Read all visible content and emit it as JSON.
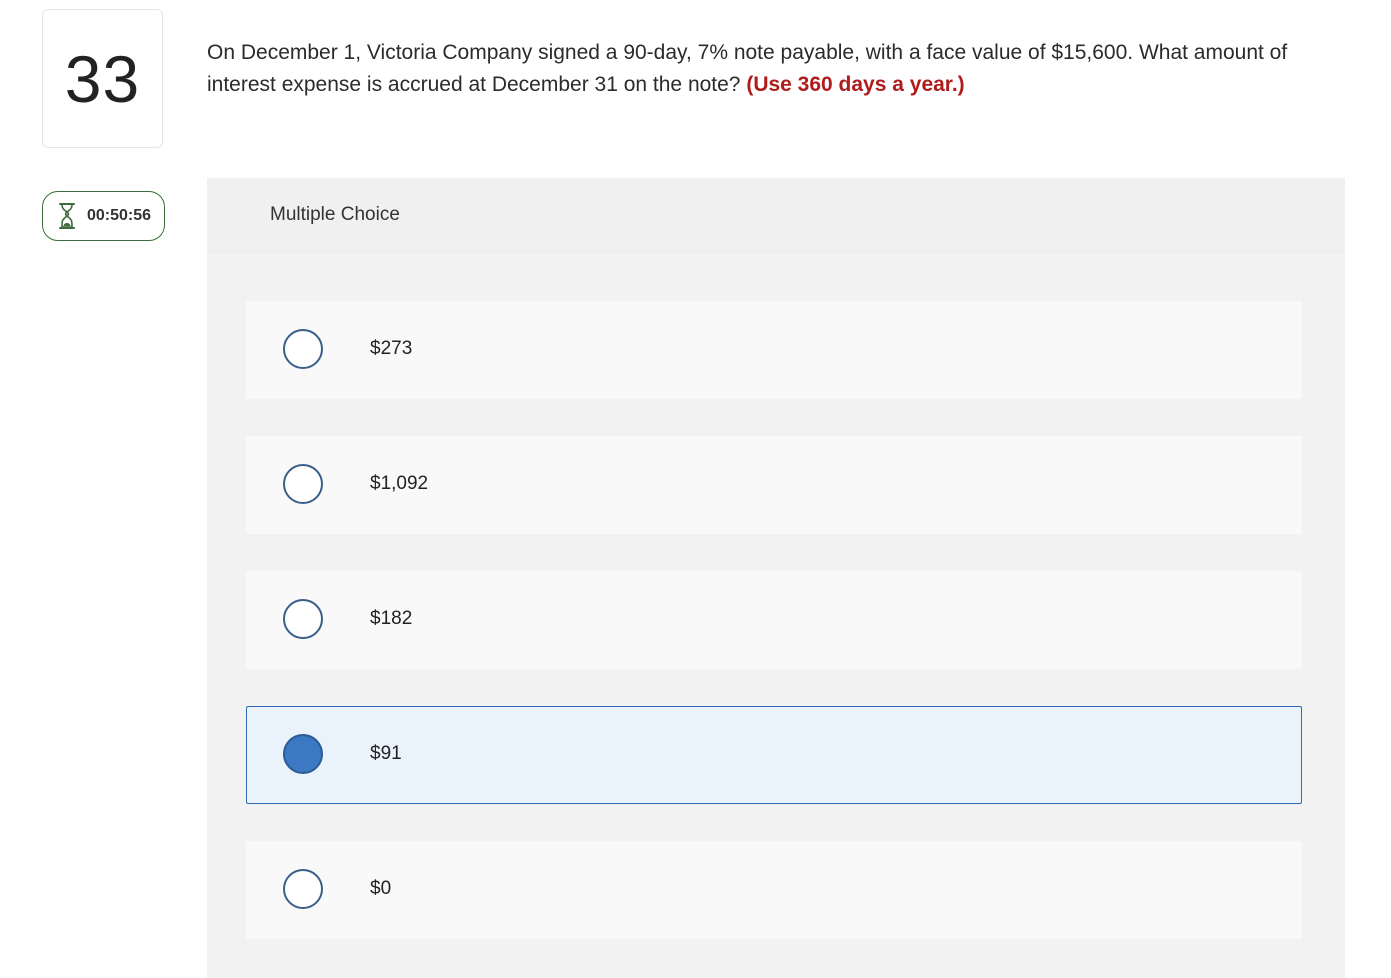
{
  "question": {
    "number": "33",
    "text": "On December 1, Victoria Company signed a 90-day, 7% note payable, with a face value of $15,600. What amount of interest expense is accrued at December 31 on the note? ",
    "hint": "(Use 360 days a year.)"
  },
  "timer": {
    "icon": "hourglass-icon",
    "value": "00:50:56",
    "color": "#3d6b3d"
  },
  "multiple_choice": {
    "label": "Multiple Choice",
    "selected_index": 3,
    "options": [
      {
        "label": "$273",
        "selected": false
      },
      {
        "label": "$1,092",
        "selected": false
      },
      {
        "label": "$182",
        "selected": false
      },
      {
        "label": "$91",
        "selected": true
      },
      {
        "label": "$0",
        "selected": false
      }
    ]
  },
  "colors": {
    "hint": "#b01c1c",
    "selected_fill": "#3c78c3",
    "selected_bg": "#eaf2fb"
  }
}
